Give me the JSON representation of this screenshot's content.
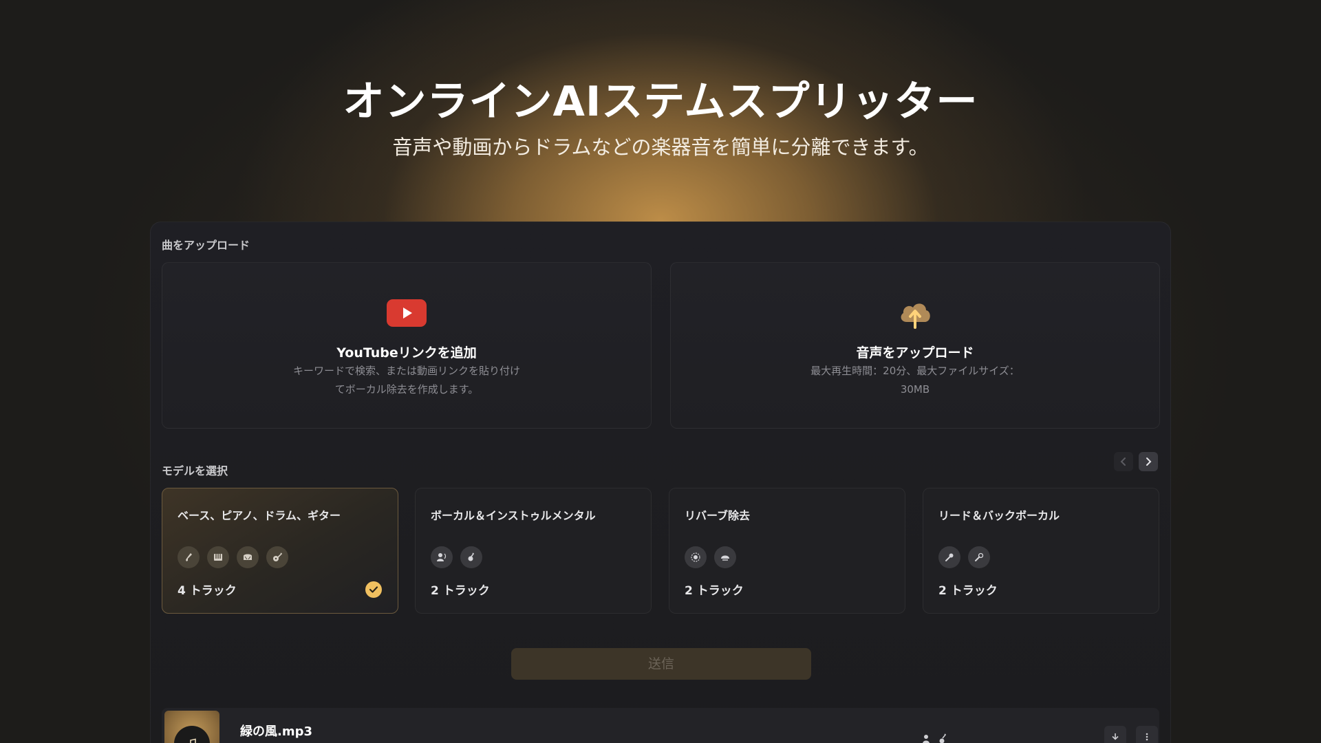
{
  "hero": {
    "title": "オンラインAIステムスプリッター",
    "subtitle": "音声や動画からドラムなどの楽器音を簡単に分離できます。"
  },
  "upload": {
    "section_label": "曲をアップロード",
    "youtube": {
      "icon": "youtube-icon",
      "title": "YouTubeリンクを追加",
      "description": "キーワードで検索、または動画リンクを貼り付けてボーカル除去を作成します。"
    },
    "audio": {
      "icon": "cloud-upload-icon",
      "title": "音声をアップロード",
      "description": "最大再生時間：20分、最大ファイルサイズ：30MB"
    }
  },
  "models": {
    "section_label": "モデルを選択",
    "items": [
      {
        "name": "ベース、ピアノ、ドラム、ギター",
        "tracks": "4 トラック",
        "selected": true,
        "icons": [
          "bass-icon",
          "piano-icon",
          "drum-icon",
          "guitar-icon"
        ]
      },
      {
        "name": "ボーカル＆インストゥルメンタル",
        "tracks": "2 トラック",
        "selected": false,
        "icons": [
          "vocal-icon",
          "instrument-icon"
        ]
      },
      {
        "name": "リバーブ除去",
        "tracks": "2 トラック",
        "selected": false,
        "icons": [
          "reverb-icon",
          "dry-icon"
        ]
      },
      {
        "name": "リード＆バックボーカル",
        "tracks": "2 トラック",
        "selected": false,
        "icons": [
          "lead-mic-icon",
          "back-mic-icon"
        ]
      }
    ]
  },
  "submit_label": "送信",
  "file": {
    "name": "緑の風.mp3"
  },
  "colors": {
    "accent": "#f0c060",
    "youtube_red": "#d93a30",
    "panel": "#1f1f24"
  }
}
